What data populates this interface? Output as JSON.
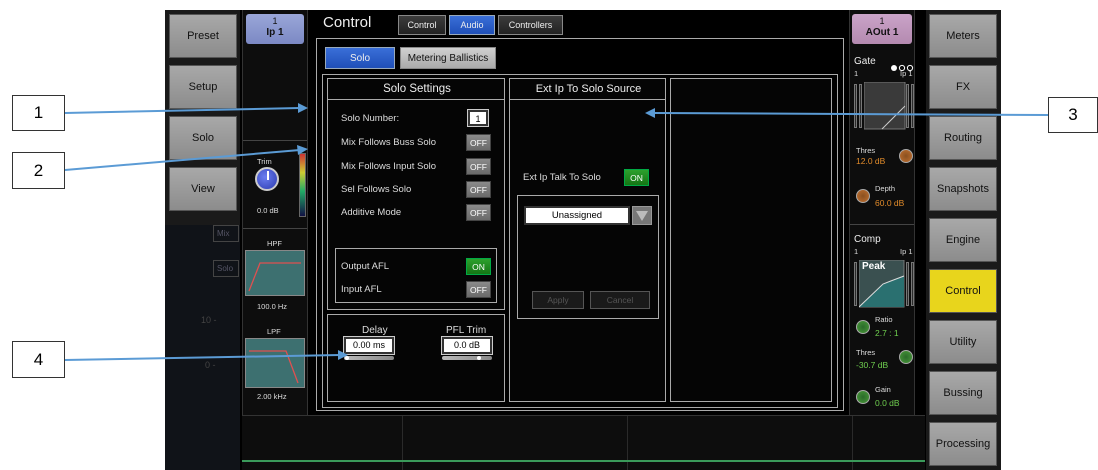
{
  "callouts": {
    "c1": "1",
    "c2": "2",
    "c3": "3",
    "c4": "4"
  },
  "left_buttons": [
    "Preset",
    "Setup",
    "Solo",
    "View"
  ],
  "right_buttons": [
    "Meters",
    "FX",
    "Routing",
    "Snapshots",
    "Engine",
    "Control",
    "Utility",
    "Bussing",
    "Processing"
  ],
  "active_right": "Control",
  "left_channel": {
    "number": "1",
    "name": "Ip 1",
    "trim_label": "Trim",
    "trim_value": "0.0 dB",
    "hpf_label": "HPF",
    "hpf_value": "100.0 Hz",
    "lpf_label": "LPF",
    "lpf_value": "2.00 kHz"
  },
  "bg_fragments": {
    "mix": "Mix",
    "solo": "Solo",
    "ten": "10 -",
    "zero": "0 -"
  },
  "header": {
    "title": "Control",
    "tabs": [
      "Control",
      "Audio",
      "Controllers"
    ],
    "active_tab": "Audio"
  },
  "subtabs": [
    "Solo",
    "Metering Ballistics"
  ],
  "solo_settings": {
    "title": "Solo Settings",
    "solo_number_label": "Solo Number:",
    "solo_number_value": "1",
    "rows": [
      {
        "label": "Mix Follows Buss Solo",
        "state": "OFF"
      },
      {
        "label": "Mix Follows Input Solo",
        "state": "OFF"
      },
      {
        "label": "Sel Follows Solo",
        "state": "OFF"
      },
      {
        "label": "Additive Mode",
        "state": "OFF"
      }
    ],
    "output_afl_label": "Output AFL",
    "output_afl_state": "ON",
    "input_afl_label": "Input AFL",
    "input_afl_state": "OFF"
  },
  "delay": {
    "label": "Delay",
    "value": "0.00 ms",
    "pfl_label": "PFL Trim",
    "pfl_value": "0.0 dB"
  },
  "ext": {
    "title": "Ext Ip To Solo Source",
    "talk_label": "Ext Ip Talk To Solo",
    "talk_state": "ON",
    "dropdown_value": "Unassigned",
    "apply": "Apply",
    "cancel": "Cancel"
  },
  "right_channel": {
    "number": "1",
    "name": "AOut 1",
    "gate_label": "Gate",
    "gate_left": "1",
    "gate_right": "Ip 1",
    "gate_thres_label": "Thres",
    "gate_thres_value": "12.0 dB",
    "gate_depth_label": "Depth",
    "gate_depth_value": "60.0 dB",
    "comp_label": "Comp",
    "comp_left": "1",
    "comp_right": "Ip 1",
    "comp_peak": "Peak",
    "ratio_label": "Ratio",
    "ratio_value": "2.7 : 1",
    "comp_thres_label": "Thres",
    "comp_thres_value": "-30.7 dB",
    "gain_label": "Gain",
    "gain_value": "0.0 dB"
  },
  "colors": {
    "accent_blue": "#2a5fd0",
    "on_green": "#1f8f1f",
    "active_yellow": "#e8d51c",
    "callout_line": "#5b9bd5"
  }
}
